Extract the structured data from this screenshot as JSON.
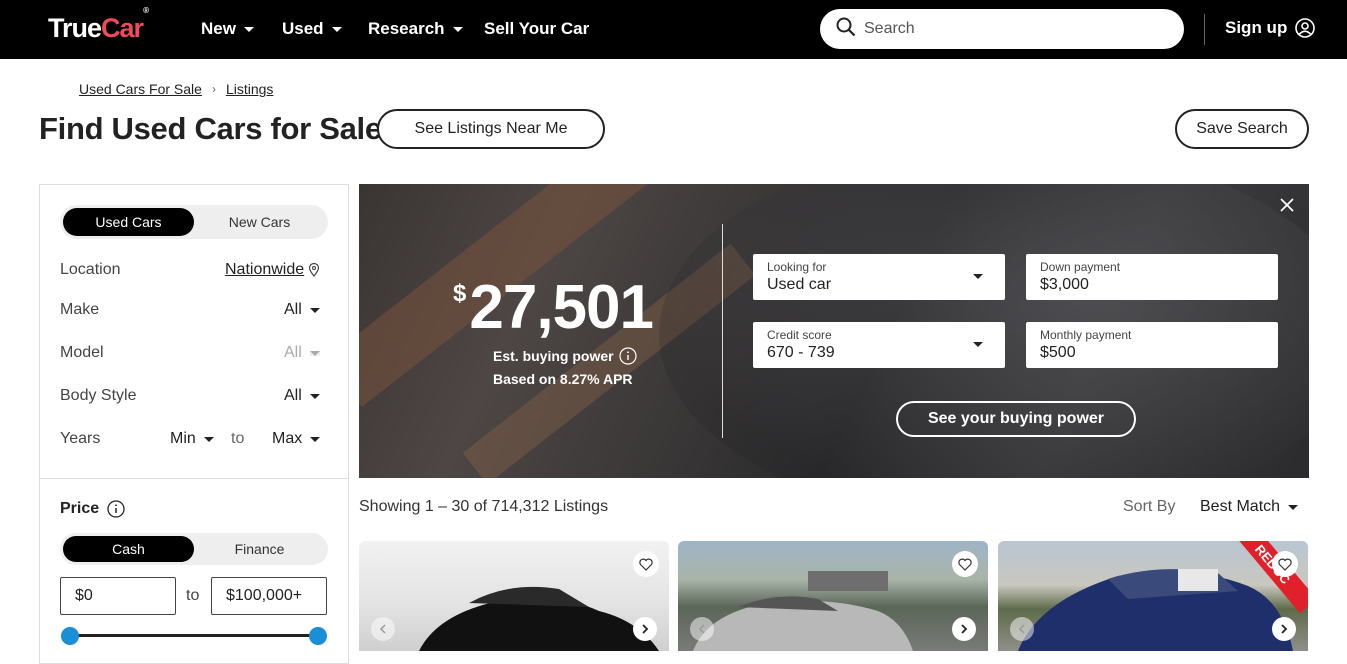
{
  "header": {
    "logo_true": "True",
    "logo_car": "Car",
    "logo_mark": "®",
    "nav": [
      "New",
      "Used",
      "Research",
      "Sell Your Car"
    ],
    "search_placeholder": "Search",
    "signup_label": "Sign up"
  },
  "breadcrumb": [
    "Used Cars For Sale",
    "Listings"
  ],
  "page_title": "Find Used Cars for Sale",
  "buttons": {
    "see_listings_near_me": "See Listings Near Me",
    "save_search": "Save Search"
  },
  "filters": {
    "tabs": [
      "Used Cars",
      "New Cars"
    ],
    "active_tab": "Used Cars",
    "location_label": "Location",
    "location_value": "Nationwide",
    "make_label": "Make",
    "make_value": "All",
    "model_label": "Model",
    "model_value": "All",
    "body_style_label": "Body Style",
    "body_style_value": "All",
    "years_label": "Years",
    "years_min": "Min",
    "years_to": "to",
    "years_max": "Max",
    "price_label": "Price",
    "price_tabs": [
      "Cash",
      "Finance"
    ],
    "price_min": "$0",
    "price_to": "to",
    "price_max": "$100,000+"
  },
  "hero": {
    "dollar_sign": "$",
    "amount": "27,501",
    "est_label": "Est. buying power",
    "apr_label": "Based on 8.27% APR",
    "looking_for_label": "Looking for",
    "looking_for_value": "Used car",
    "down_payment_label": "Down payment",
    "down_payment_value": "$3,000",
    "credit_score_label": "Credit score",
    "credit_score_value": "670 - 739",
    "monthly_payment_label": "Monthly payment",
    "monthly_payment_value": "$500",
    "cta": "See your buying power"
  },
  "results": {
    "count_text": "Showing 1 – 30 of 714,312 Listings",
    "sort_label": "Sort By",
    "sort_value": "Best Match",
    "card3_ribbon": "REDUC"
  },
  "colors": {
    "brand_red": "#f14b5b",
    "slider_blue": "#1a8fd6"
  }
}
